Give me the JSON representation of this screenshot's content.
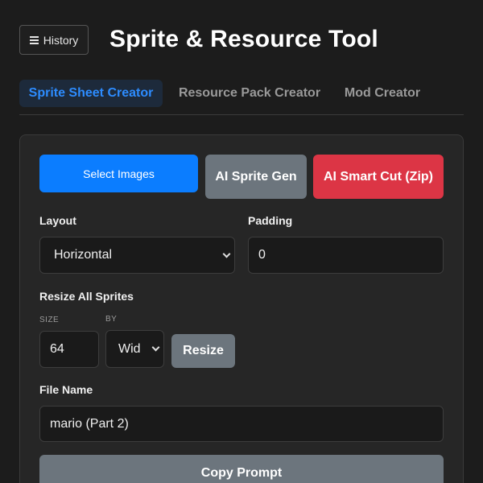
{
  "header": {
    "history_label": "History",
    "history_icon": "menu-icon",
    "title": "Sprite & Resource Tool"
  },
  "tabs": [
    {
      "label": "Sprite Sheet Creator",
      "active": true
    },
    {
      "label": "Resource Pack Creator",
      "active": false
    },
    {
      "label": "Mod Creator",
      "active": false
    }
  ],
  "actions": {
    "select_images": "Select Images",
    "ai_sprite_gen": "AI Sprite Gen",
    "ai_smart_cut": "AI Smart Cut (Zip)"
  },
  "layout": {
    "label": "Layout",
    "value": "Horizontal"
  },
  "padding": {
    "label": "Padding",
    "value": "0"
  },
  "resize": {
    "label": "Resize All Sprites",
    "size_label": "SIZE",
    "size_value": "64",
    "by_label": "BY",
    "by_value": "Wid",
    "button": "Resize"
  },
  "file_name": {
    "label": "File Name",
    "value": "mario (Part 2)"
  },
  "copy_prompt": "Copy Prompt",
  "colors": {
    "accent": "#0b7dff",
    "secondary": "#6c757d",
    "danger": "#dc3545",
    "background": "#1c1c1c"
  }
}
